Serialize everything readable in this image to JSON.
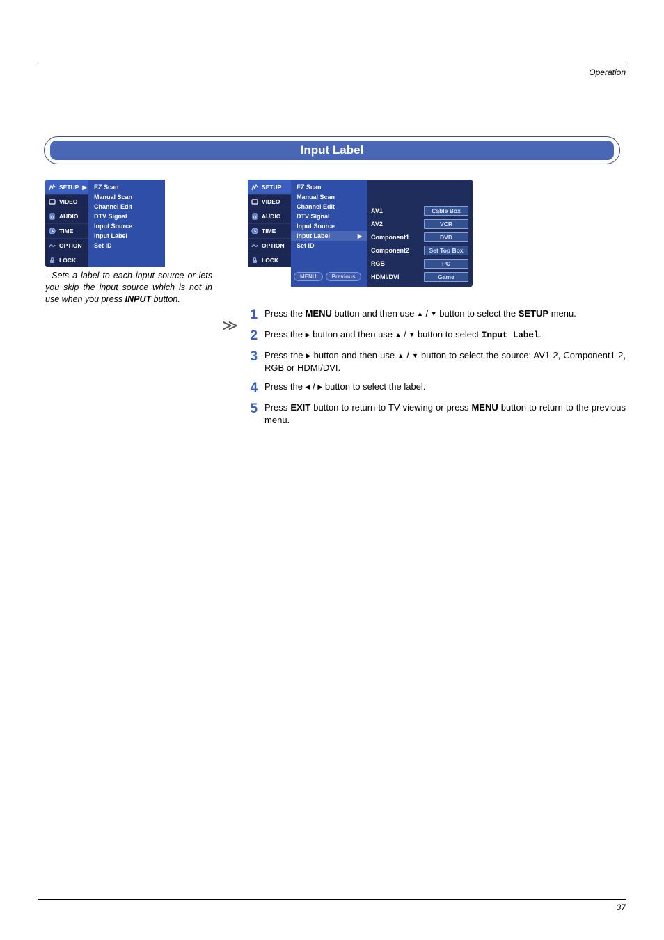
{
  "header": {
    "section": "Operation"
  },
  "title": "Input Label",
  "page_number": "37",
  "menu_left": {
    "tabs": [
      {
        "label": "SETUP",
        "selected": true,
        "chevron": "▶"
      },
      {
        "label": "VIDEO"
      },
      {
        "label": "AUDIO"
      },
      {
        "label": "TIME"
      },
      {
        "label": "OPTION"
      },
      {
        "label": "LOCK"
      }
    ],
    "items": [
      {
        "label": "EZ Scan"
      },
      {
        "label": "Manual Scan"
      },
      {
        "label": "Channel Edit"
      },
      {
        "label": "DTV Signal"
      },
      {
        "label": "Input Source"
      },
      {
        "label": "Input Label"
      },
      {
        "label": "Set ID"
      }
    ]
  },
  "menu_right": {
    "tabs": [
      {
        "label": "SETUP",
        "selected": true
      },
      {
        "label": "VIDEO"
      },
      {
        "label": "AUDIO"
      },
      {
        "label": "TIME"
      },
      {
        "label": "OPTION"
      },
      {
        "label": "LOCK"
      }
    ],
    "items": [
      {
        "label": "EZ Scan"
      },
      {
        "label": "Manual Scan"
      },
      {
        "label": "Channel Edit"
      },
      {
        "label": "DTV Signal"
      },
      {
        "label": "Input Source"
      },
      {
        "label": "Input Label",
        "selected": true,
        "chevron": "▶"
      },
      {
        "label": "Set ID"
      }
    ],
    "footer": [
      "MENU",
      "Previous"
    ],
    "sub_items": [
      {
        "label": "AV1",
        "value": "Cable Box"
      },
      {
        "label": "AV2",
        "value": "VCR"
      },
      {
        "label": "Component1",
        "value": "DVD"
      },
      {
        "label": "Component2",
        "value": "Set Top Box"
      },
      {
        "label": "RGB",
        "value": "PC"
      },
      {
        "label": "HDMI/DVI",
        "value": "Game"
      }
    ]
  },
  "description": {
    "prefix": "- ",
    "text1": "Sets a label to each input source or lets you skip the input source which is not in use when you press ",
    "bold": "INPUT",
    "text2": " button."
  },
  "steps": {
    "s1": {
      "a": "Press the ",
      "b": "MENU",
      "c": " button and then use ",
      "d": " button to select the ",
      "e": "SETUP",
      "f": " menu."
    },
    "s2": {
      "a": "Press the ",
      "b": " button and then use ",
      "c": " button to select  ",
      "d": "Input Label",
      "e": "."
    },
    "s3": {
      "a": "Press the ",
      "b": " button and then use ",
      "c": " button to select the source: AV1-2, Component1-2, RGB or HDMI/DVI."
    },
    "s4": {
      "a": "Press the ",
      "b": " button to select the label."
    },
    "s5": {
      "a": "Press ",
      "b": "EXIT",
      "c": " button to return to TV viewing or press ",
      "d": "MENU",
      "e": " button to return to the previous menu."
    }
  },
  "glyphs": {
    "up": "▲",
    "down": "▼",
    "left": "◀",
    "right": "▶",
    "slash": " / ",
    "big_arrow": "≫"
  }
}
